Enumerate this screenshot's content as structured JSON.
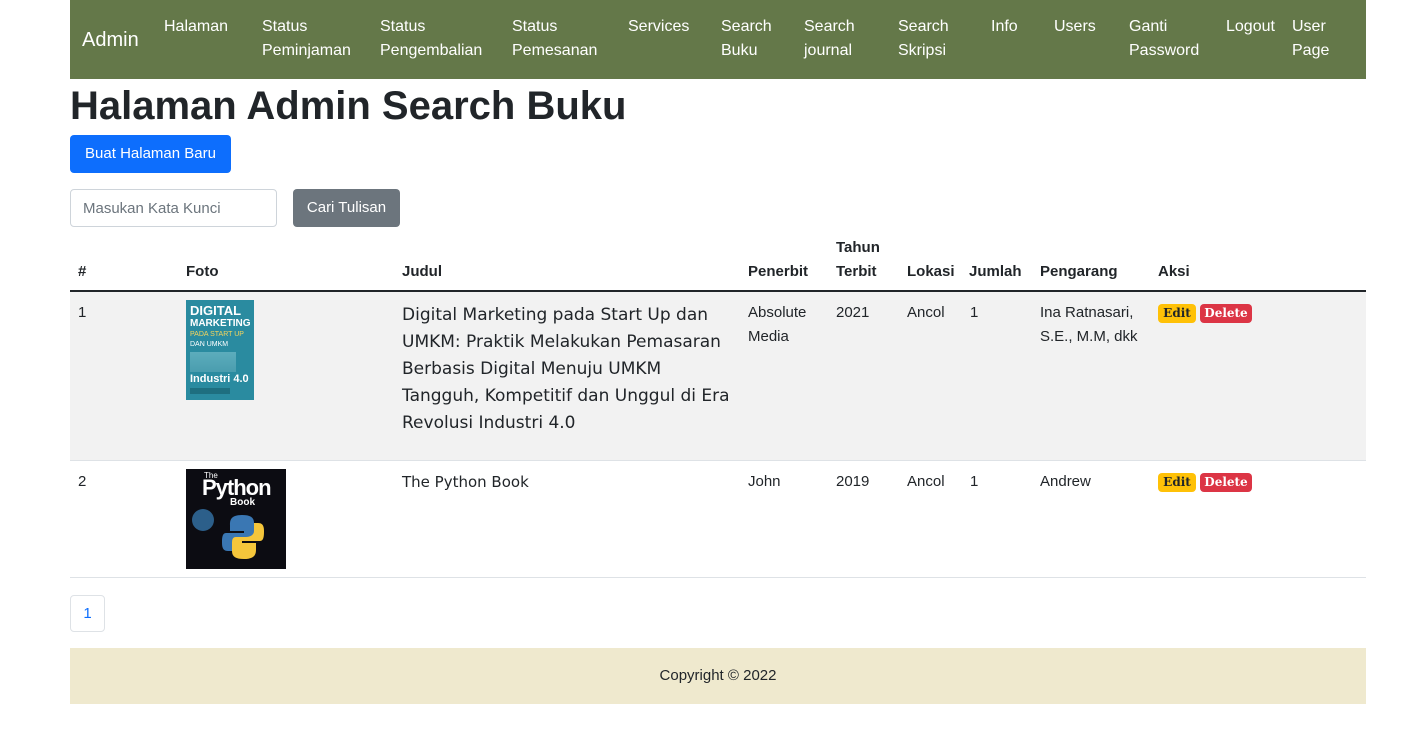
{
  "navbar": {
    "brand": "Admin",
    "items": [
      {
        "line1": "Halaman",
        "line2": ""
      },
      {
        "line1": "Status",
        "line2": "Peminjaman"
      },
      {
        "line1": "Status",
        "line2": "Pengembalian"
      },
      {
        "line1": "Status",
        "line2": "Pemesanan"
      },
      {
        "line1": "Services",
        "line2": ""
      },
      {
        "line1": "Search",
        "line2": "Buku"
      },
      {
        "line1": "Search",
        "line2": "journal"
      },
      {
        "line1": "Search",
        "line2": "Skripsi"
      },
      {
        "line1": "Info",
        "line2": ""
      },
      {
        "line1": "Users",
        "line2": ""
      },
      {
        "line1": "Ganti",
        "line2": "Password"
      },
      {
        "line1": "Logout",
        "line2": ""
      },
      {
        "line1": "User",
        "line2": "Page"
      }
    ]
  },
  "page_title": "Halaman Admin Search Buku",
  "create_button": "Buat Halaman Baru",
  "search": {
    "placeholder": "Masukan Kata Kunci",
    "button": "Cari Tulisan"
  },
  "table": {
    "headers": {
      "no": "#",
      "foto": "Foto",
      "judul": "Judul",
      "penerbit": "Penerbit",
      "tahun_line1": "Tahun",
      "tahun_line2": "Terbit",
      "lokasi": "Lokasi",
      "jumlah": "Jumlah",
      "pengarang": "Pengarang",
      "aksi": "Aksi"
    },
    "rows": [
      {
        "no": "1",
        "cover_text": [
          "DIGITAL",
          "MARKETING",
          "PADA START UP",
          "DAN UMKM",
          "Industri 4.0"
        ],
        "judul_lines": [
          "Digital Marketing pada Start Up dan",
          "UMKM: Praktik Melakukan Pemasaran",
          "Berbasis Digital Menuju UMKM",
          "Tangguh, Kompetitif dan Unggul di Era",
          "Revolusi Industri 4.0"
        ],
        "penerbit_lines": [
          "Absolute",
          "Media"
        ],
        "tahun": "2021",
        "lokasi": "Ancol",
        "jumlah": "1",
        "pengarang_lines": [
          "Ina Ratnasari,",
          "S.E., M.M, dkk"
        ],
        "edit": "Edit",
        "delete": "Delete"
      },
      {
        "no": "2",
        "cover_text": [
          "The",
          "Python",
          "Book"
        ],
        "judul": "The Python Book",
        "penerbit": "John",
        "tahun": "2019",
        "lokasi": "Ancol",
        "jumlah": "1",
        "pengarang": "Andrew",
        "edit": "Edit",
        "delete": "Delete"
      }
    ]
  },
  "pagination": {
    "current": "1"
  },
  "footer": "Copyright © 2022",
  "colors": {
    "navbar": "#647849",
    "primary": "#0d6efd",
    "secondary": "#6c757d",
    "edit": "#ffc107",
    "delete": "#dc3545",
    "footer": "#efe9ce"
  }
}
